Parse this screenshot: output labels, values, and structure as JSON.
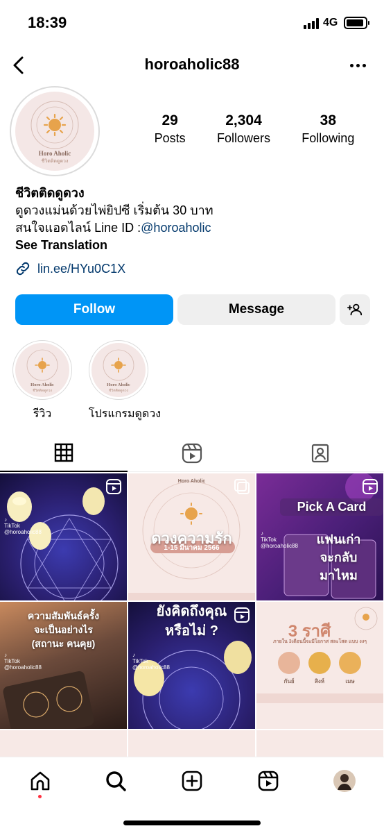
{
  "status_bar": {
    "time": "18:39",
    "network": "4G"
  },
  "header": {
    "username": "horoaholic88"
  },
  "profile": {
    "logo_text": "Horo Aholic",
    "logo_subtext": "ชีวิตติดดูดวง",
    "stats": [
      {
        "value": "29",
        "label": "Posts"
      },
      {
        "value": "2,304",
        "label": "Followers"
      },
      {
        "value": "38",
        "label": "Following"
      }
    ],
    "bio": {
      "name": "ชีวิตติดดูดวง",
      "line1": "ดูดวงแม่นด้วยไพ่ยิปซี เริ่มต้น 30 บาท",
      "line2_prefix": "สนใจแอดไลน์ Line ID :",
      "line2_link": "@horoaholic",
      "translate": "See Translation"
    },
    "link": "lin.ee/HYu0C1X"
  },
  "actions": {
    "follow": "Follow",
    "message": "Message"
  },
  "highlights": [
    {
      "label": "รีวิว"
    },
    {
      "label": "โปรแกรมดูดวง"
    }
  ],
  "grid": {
    "tiktok_label": "TikTok",
    "tiktok_handle": "@horoaholic88",
    "post2_title": "ดวงความรัก",
    "post2_date": "1-15 มีนาคม 2566",
    "post3_title": "Pick A Card",
    "post3_line1": "แฟนเก่า",
    "post3_line2": "จะกลับ",
    "post3_line3": "มาไหม",
    "post4_line1": "ความสัมพันธ์ครั้ง",
    "post4_line2": "จะเป็นอย่างไร",
    "post4_line3": "(สถานะ คนคุย)",
    "post5_line1": "ยังคิดถึงคุณ",
    "post5_line2": "หรือไม่ ?",
    "post6_title": "3 ราศี",
    "post6_sub": "ภายใน 3เดือนนี้จะมีโอกาส สละโสด แบบ งงๆ",
    "post6_signs": [
      "กันย์",
      "สิงห์",
      "เมษ"
    ]
  },
  "colors": {
    "accent": "#0095f6",
    "link": "#00376b",
    "notification": "#ff3040"
  }
}
